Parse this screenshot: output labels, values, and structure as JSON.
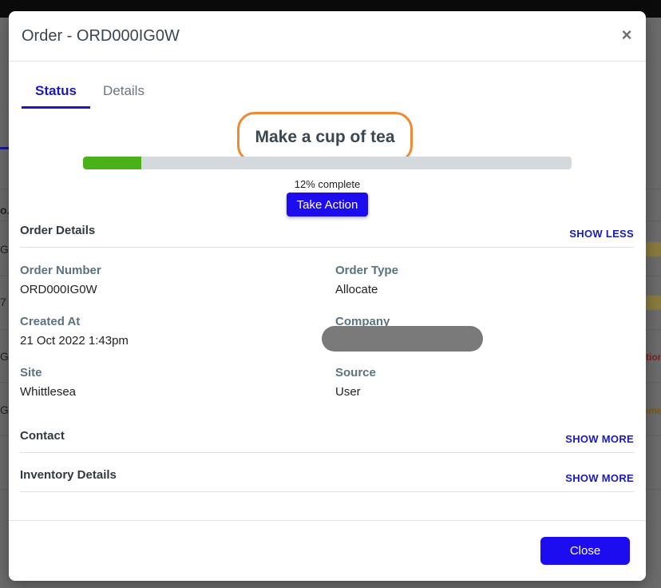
{
  "background": {
    "fragments": [
      {
        "text": "o.",
        "bold": true
      },
      {
        "text": "G",
        "bold": false
      },
      {
        "text": "7",
        "bold": false
      },
      {
        "text": "G",
        "bold": false
      },
      {
        "text": "G",
        "bold": false
      }
    ],
    "right_texts": [
      "tion",
      "ime"
    ]
  },
  "modal": {
    "title": "Order - ORD000IG0W",
    "close_icon": "×"
  },
  "tabs": [
    {
      "label": "Status",
      "active": true
    },
    {
      "label": "Details",
      "active": false
    }
  ],
  "status": {
    "title": "Make a cup of tea",
    "progress": 0.12,
    "progress_label": "12% complete",
    "action_label": "Take Action"
  },
  "order_details": {
    "title": "Order Details",
    "toggle_label": "SHOW LESS",
    "fields": {
      "order_number": {
        "label": "Order Number",
        "value": "ORD000IG0W"
      },
      "order_type": {
        "label": "Order Type",
        "value": "Allocate"
      },
      "created_at": {
        "label": "Created At",
        "value": "21 Oct 2022 1:43pm"
      },
      "company": {
        "label": "Company",
        "value": ""
      },
      "site": {
        "label": "Site",
        "value": "Whittlesea"
      },
      "source": {
        "label": "Source",
        "value": "User"
      }
    }
  },
  "contact": {
    "title": "Contact",
    "toggle_label": "SHOW MORE"
  },
  "inventory": {
    "title": "Inventory Details",
    "toggle_label": "SHOW MORE"
  },
  "footer": {
    "close_label": "Close"
  },
  "colors": {
    "accent": "#1e0cf0",
    "progress": "#49b21b",
    "highlight": "#f08a32"
  }
}
